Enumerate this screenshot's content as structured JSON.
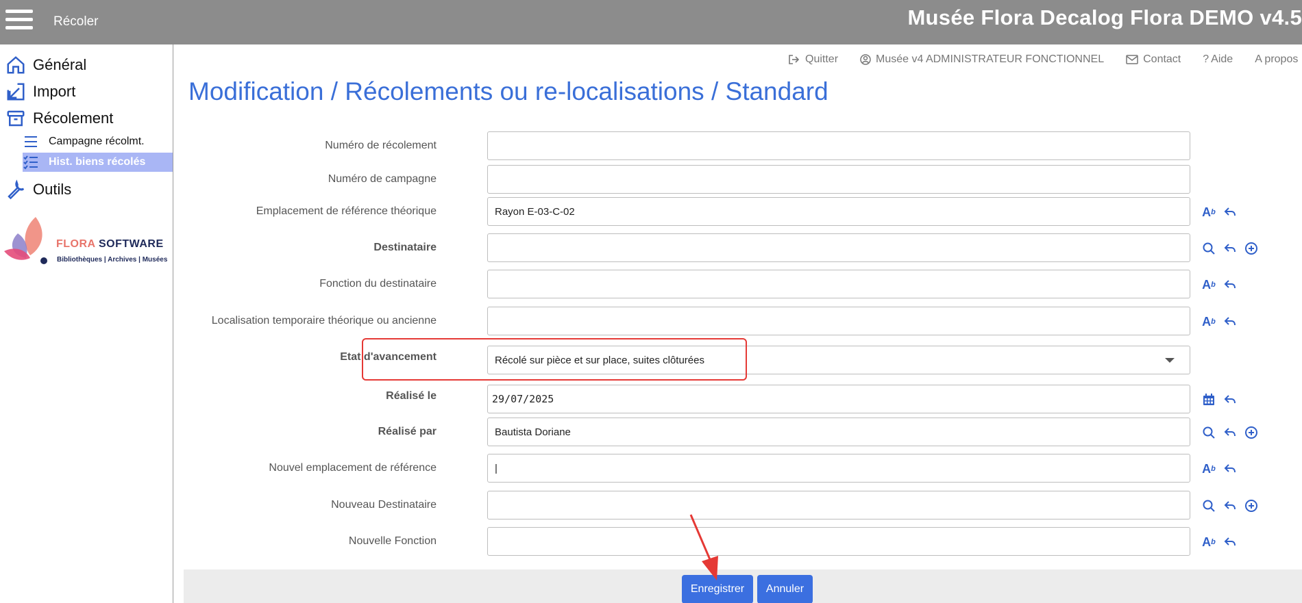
{
  "topbar": {
    "module_title": "Récoler",
    "app_title": "Musée Flora Decalog Flora DEMO v4.5"
  },
  "sidebar": {
    "items": [
      {
        "label": "Général",
        "icon": "home-icon"
      },
      {
        "label": "Import",
        "icon": "import-icon"
      },
      {
        "label": "Récolement",
        "icon": "archive-icon"
      },
      {
        "label": "Outils",
        "icon": "wrench-icon"
      }
    ],
    "subitems": [
      {
        "label": "Campagne récolmt.",
        "icon": "list-icon"
      },
      {
        "label": "Hist. biens récolés",
        "icon": "checklist-icon",
        "active": true
      }
    ],
    "logo": {
      "brand_a": "FLORA",
      "brand_b": " SOFTWARE",
      "tagline": "Bibliothèques | Archives | Musées"
    }
  },
  "header_links": {
    "quit": "Quitter",
    "user": "Musée v4 ADMINISTRATEUR FONCTIONNEL",
    "contact": "Contact",
    "help": "Aide",
    "about": "A propos"
  },
  "page_title": "Modification / Récolements ou re-localisations / Standard",
  "form": {
    "fields": [
      {
        "label": "Numéro de récolement",
        "value": ""
      },
      {
        "label": "Numéro de campagne",
        "value": ""
      },
      {
        "label": "Emplacement de référence théorique",
        "value": "Rayon E-03-C-02"
      },
      {
        "label": "Destinataire",
        "value": ""
      },
      {
        "label": "Fonction du destinataire",
        "value": ""
      },
      {
        "label": "Localisation temporaire théorique ou ancienne",
        "value": ""
      },
      {
        "label": "Etat d'avancement",
        "value": "Récolé sur pièce et sur place, suites clôturées"
      },
      {
        "label": "Réalisé le",
        "value": "29/07/2025"
      },
      {
        "label": "Réalisé par",
        "value": "Bautista Doriane"
      },
      {
        "label": "Nouvel emplacement de référence",
        "value": "|"
      },
      {
        "label": "Nouveau Destinataire",
        "value": ""
      },
      {
        "label": "Nouvelle Fonction",
        "value": ""
      }
    ]
  },
  "buttons": {
    "save": "Enregistrer",
    "cancel": "Annuler"
  },
  "colors": {
    "accent": "#3b6fe0",
    "title": "#3a6fd8",
    "topbar": "#8c8c8c",
    "active_nav": "#a9b6f5",
    "highlight": "#e53935"
  }
}
